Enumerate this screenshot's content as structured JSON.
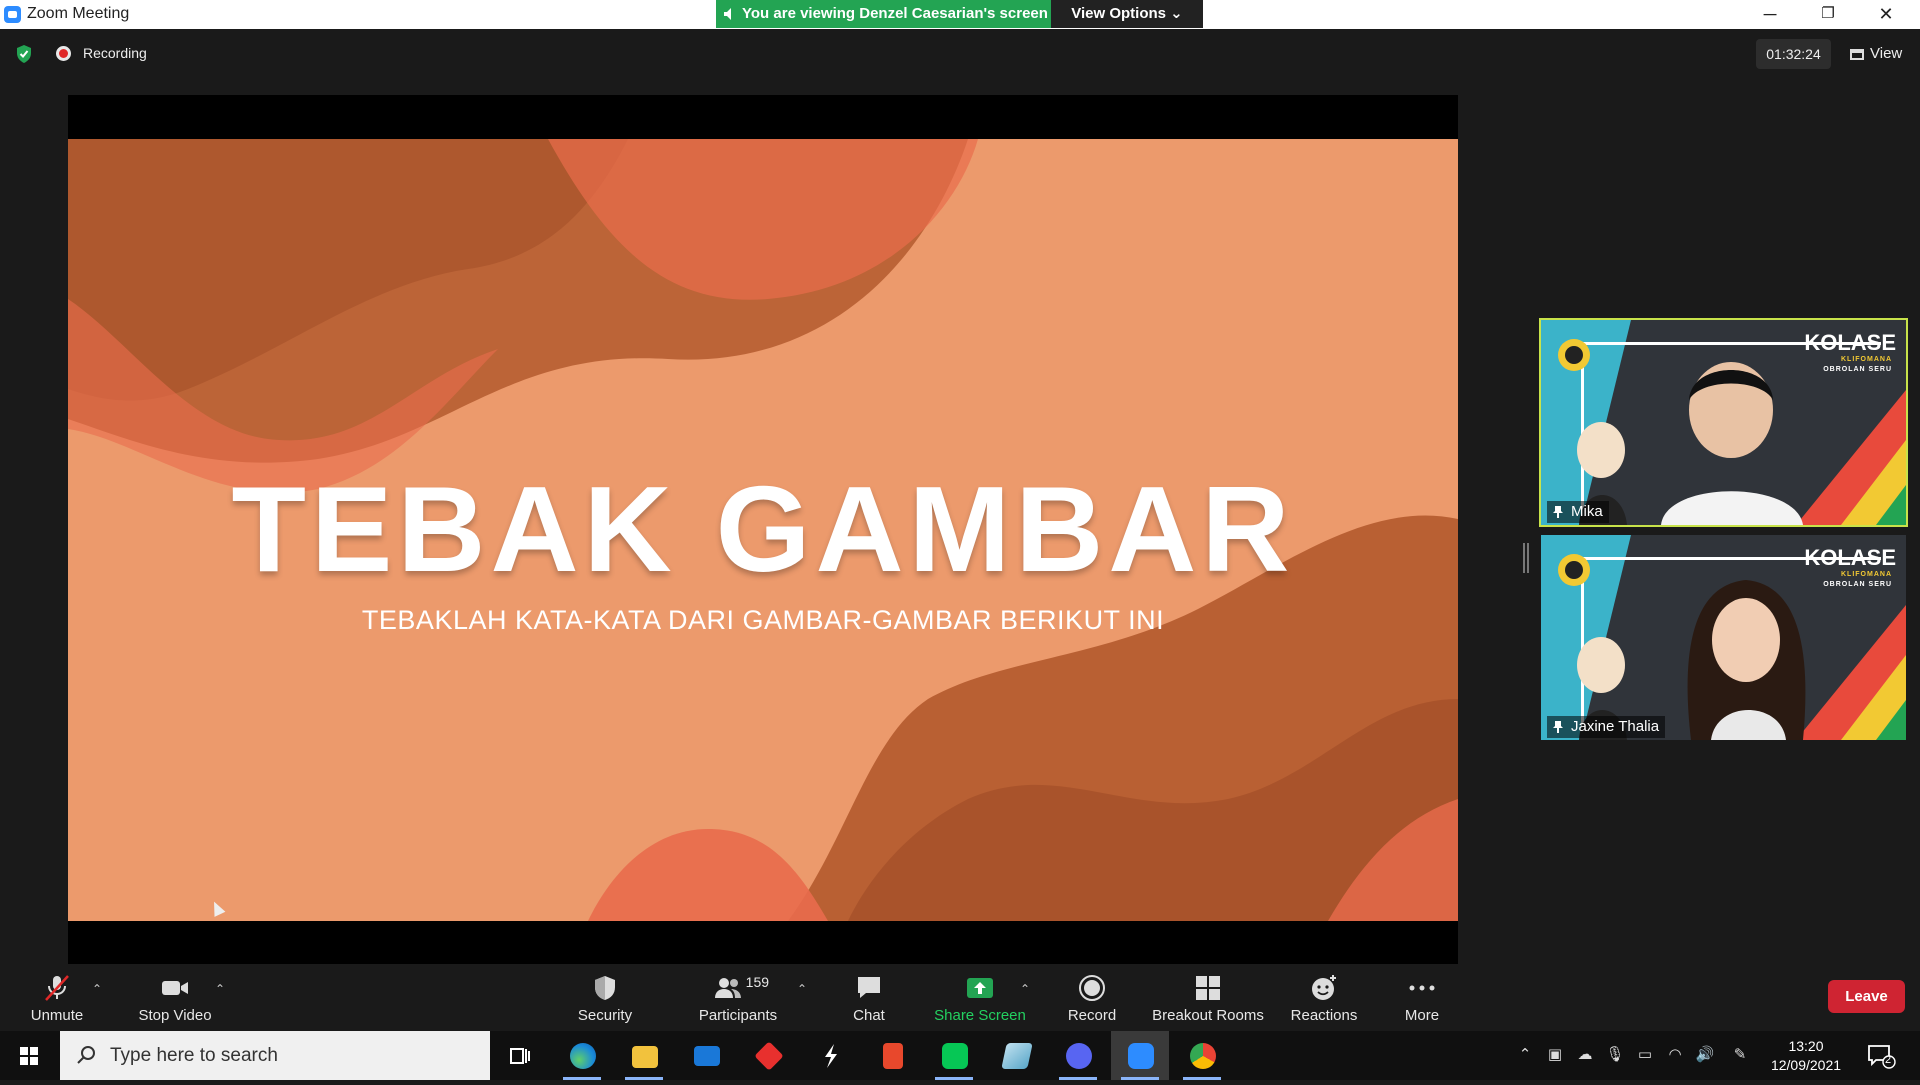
{
  "window": {
    "title": "Zoom Meeting",
    "viewing_banner": "You are viewing Denzel Caesarian's screen",
    "view_options_label": "View Options",
    "minimize": "─",
    "restore": "❐",
    "close": "✕"
  },
  "meeting_header": {
    "recording_label": "Recording",
    "elapsed_time": "01:32:24",
    "view_label": "View"
  },
  "slide": {
    "title": "TEBAK GAMBAR",
    "subtitle": "TEBAKLAH KATA-KATA DARI GAMBAR-GAMBAR BERIKUT INI"
  },
  "participants_tiles": [
    {
      "name": "Mika",
      "overlay_brand": "KOLASE",
      "overlay_sub1": "KLIFOMANA",
      "overlay_sub2": "OBROLAN SERU",
      "active_speaker": true
    },
    {
      "name": "Jaxine Thalia",
      "overlay_brand": "KOLASE",
      "overlay_sub1": "KLIFOMANA",
      "overlay_sub2": "OBROLAN SERU",
      "active_speaker": false
    }
  ],
  "toolbar": {
    "unmute": "Unmute",
    "stop_video": "Stop Video",
    "security": "Security",
    "participants": "Participants",
    "participant_count": "159",
    "chat": "Chat",
    "share_screen": "Share Screen",
    "record": "Record",
    "breakout_rooms": "Breakout Rooms",
    "reactions": "Reactions",
    "more": "More",
    "leave": "Leave"
  },
  "taskbar": {
    "search_placeholder": "Type here to search",
    "time": "13:20",
    "date": "12/09/2021",
    "notification_count": "2",
    "apps": [
      "task-view",
      "edge",
      "file-explorer",
      "mail",
      "git-app",
      "app-s",
      "office",
      "line",
      "notepad",
      "discord",
      "zoom",
      "chrome"
    ]
  },
  "colors": {
    "accent_green": "#23a453",
    "leave_red": "#cf2432",
    "active_outline": "#c8e34a",
    "slide_bg": "#e99468",
    "share_green": "#23a453"
  }
}
